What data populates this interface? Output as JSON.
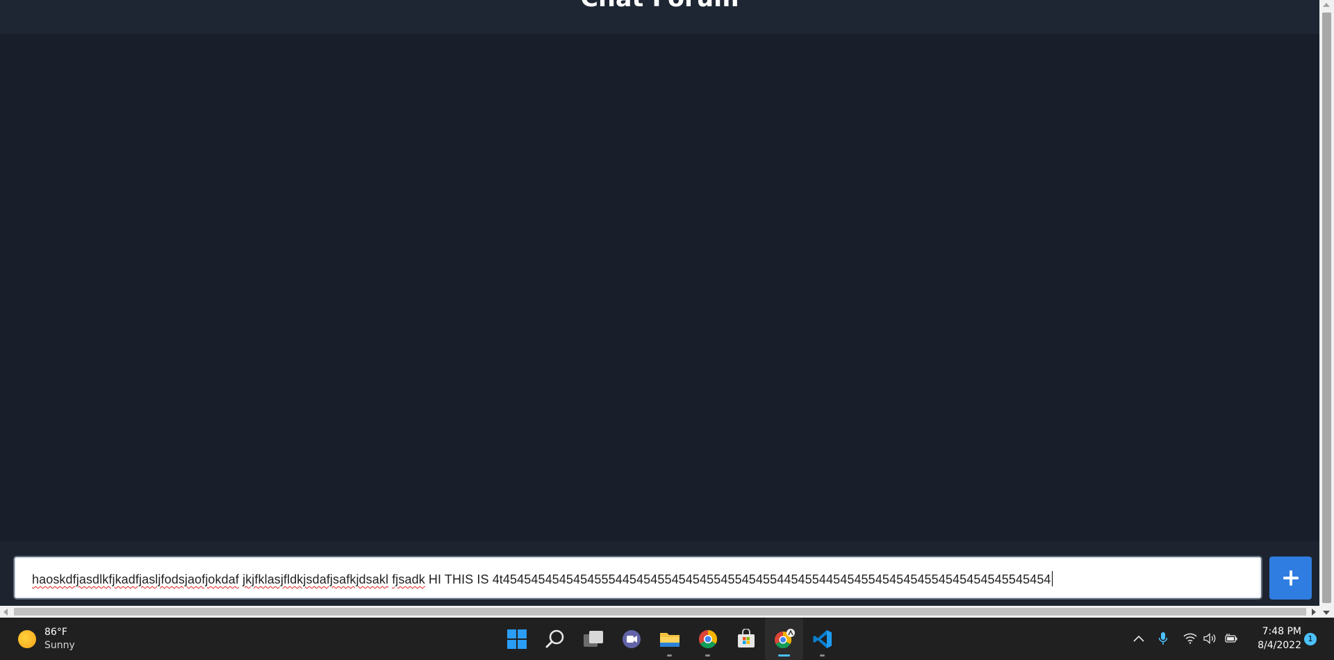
{
  "app": {
    "header_title": "Chat Forum"
  },
  "composer": {
    "segments": [
      {
        "text": "haoskdfjasdlkfjkadfjasljfodsjaofjokdaf",
        "misspelled": true
      },
      {
        "text": " ",
        "misspelled": false
      },
      {
        "text": "jkjfklasjfldkjsdafjsafkjdsakl",
        "misspelled": true
      },
      {
        "text": " ",
        "misspelled": false
      },
      {
        "text": "fjsadk",
        "misspelled": true
      },
      {
        "text": " HI THIS IS 4t454545454545455544545455454545545545455445455445454554545454554545454545545454",
        "misspelled": false
      }
    ],
    "add_button_symbol": "+",
    "add_button_color": "#2f7de0"
  },
  "taskbar": {
    "weather": {
      "temperature": "86°F",
      "condition": "Sunny",
      "icon": "sun-icon"
    },
    "apps": [
      {
        "name": "start-icon",
        "active": false,
        "running": false
      },
      {
        "name": "search-icon",
        "active": false,
        "running": false
      },
      {
        "name": "task-view-icon",
        "active": false,
        "running": false
      },
      {
        "name": "teams-chat-icon",
        "active": false,
        "running": false
      },
      {
        "name": "file-explorer-icon",
        "active": false,
        "running": true
      },
      {
        "name": "chrome-icon",
        "active": false,
        "running": true
      },
      {
        "name": "microsoft-store-icon",
        "active": false,
        "running": false
      },
      {
        "name": "chrome-profile-icon",
        "active": true,
        "running": true
      },
      {
        "name": "vscode-icon",
        "active": false,
        "running": true
      }
    ],
    "tray": {
      "time": "7:48 PM",
      "date": "8/4/2022",
      "notification_count": "1",
      "accent_color": "#4cc2ff"
    }
  }
}
